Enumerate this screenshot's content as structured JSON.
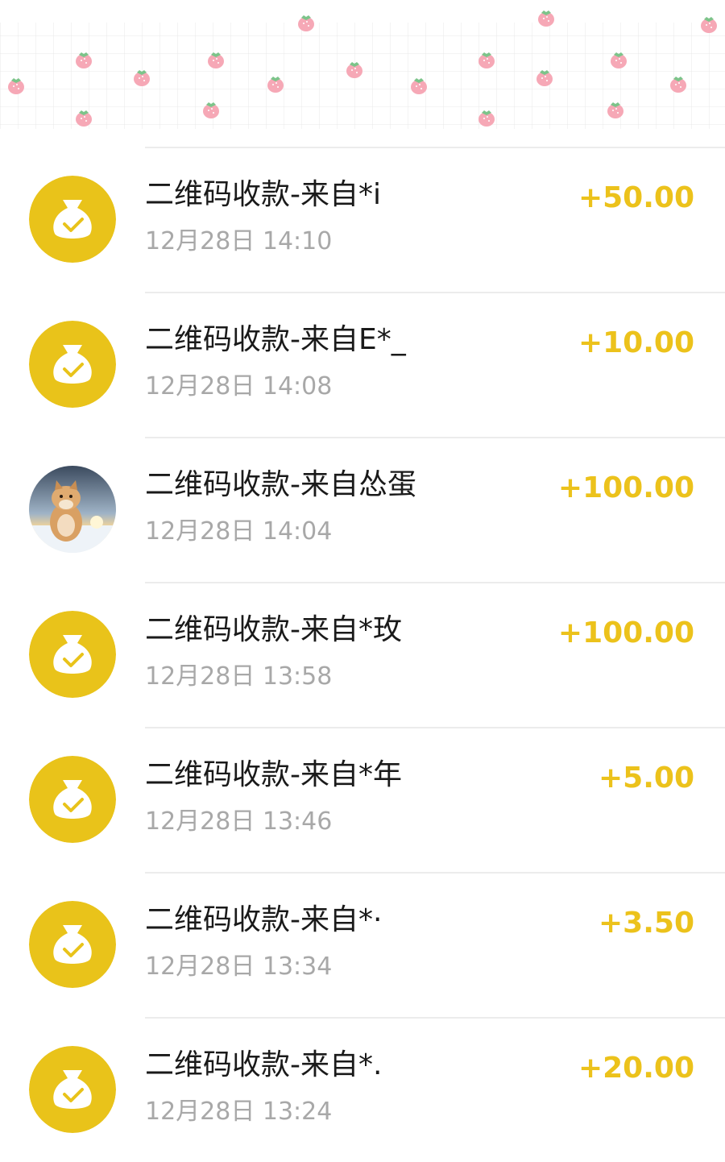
{
  "colors": {
    "accent": "#ecc21b",
    "title_text": "#1a1a1a",
    "secondary_text": "#a8a8a8",
    "divider": "#ececec"
  },
  "banner": {
    "icon": "strawberry-pattern"
  },
  "transactions": [
    {
      "title": "二维码收款-来自*i",
      "time": "12月28日 14:10",
      "amount": "+50.00",
      "icon": "money-bag-check-icon"
    },
    {
      "title": "二维码收款-来自E*_",
      "time": "12月28日 14:08",
      "amount": "+10.00",
      "icon": "money-bag-check-icon"
    },
    {
      "title": "二维码收款-来自怂蛋",
      "time": "12月28日 14:04",
      "amount": "+100.00",
      "icon": "user-avatar-photo"
    },
    {
      "title": "二维码收款-来自*玫",
      "time": "12月28日 13:58",
      "amount": "+100.00",
      "icon": "money-bag-check-icon"
    },
    {
      "title": "二维码收款-来自*年",
      "time": "12月28日 13:46",
      "amount": "+5.00",
      "icon": "money-bag-check-icon"
    },
    {
      "title": "二维码收款-来自*·",
      "time": "12月28日 13:34",
      "amount": "+3.50",
      "icon": "money-bag-check-icon"
    },
    {
      "title": "二维码收款-来自*.",
      "time": "12月28日 13:24",
      "amount": "+20.00",
      "icon": "money-bag-check-icon"
    }
  ]
}
